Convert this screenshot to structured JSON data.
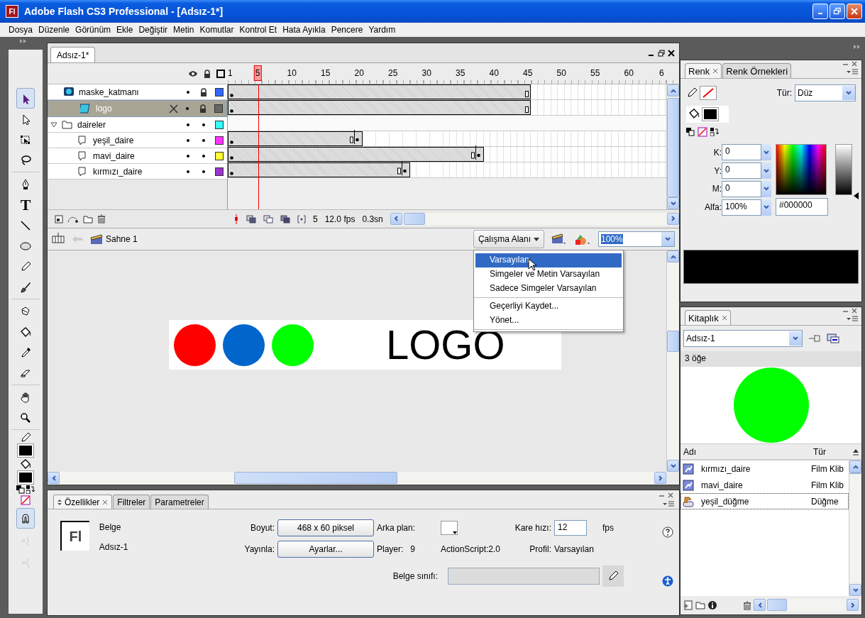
{
  "window": {
    "icon_text": "Fl",
    "title": "Adobe Flash CS3 Professional - [Adsız-1*]"
  },
  "menu": [
    "Dosya",
    "Düzenle",
    "Görünüm",
    "Ekle",
    "Değiştir",
    "Metin",
    "Komutlar",
    "Kontrol Et",
    "Hata Ayıkla",
    "Pencere",
    "Yardım"
  ],
  "toolbox": {
    "groups": [
      [
        {
          "kind": "selection",
          "selected": true
        },
        {
          "kind": "subselection",
          "selected": false
        },
        {
          "kind": "free-transform",
          "selected": false
        },
        {
          "kind": "lasso",
          "selected": false
        }
      ],
      [
        {
          "kind": "pen",
          "selected": false
        },
        {
          "kind": "text",
          "glyph": "T",
          "selected": false
        },
        {
          "kind": "line",
          "selected": false
        },
        {
          "kind": "oval",
          "selected": false
        },
        {
          "kind": "pencil",
          "selected": false
        },
        {
          "kind": "brush",
          "selected": false
        }
      ],
      [
        {
          "kind": "ink-bottle",
          "selected": false
        },
        {
          "kind": "paint-bucket",
          "selected": false
        },
        {
          "kind": "eyedropper",
          "selected": false
        },
        {
          "kind": "eraser",
          "selected": false
        }
      ],
      [
        {
          "kind": "hand",
          "selected": false
        },
        {
          "kind": "zoom",
          "selected": false
        }
      ]
    ],
    "options": [
      {
        "kind": "snap",
        "selected": true,
        "disabled": false
      },
      {
        "kind": "smooth",
        "selected": false,
        "disabled": true
      },
      {
        "kind": "straighten",
        "selected": false,
        "disabled": true
      }
    ]
  },
  "document_tabs": [
    {
      "label": "Adsız-1*",
      "selected": true
    }
  ],
  "timeline": {
    "ruler": [
      {
        "label": "1",
        "current": false
      },
      {
        "label": "5",
        "current": true
      },
      {
        "label": "10",
        "current": false
      },
      {
        "label": "15",
        "current": false
      },
      {
        "label": "20",
        "current": false
      },
      {
        "label": "25",
        "current": false
      },
      {
        "label": "30",
        "current": false
      },
      {
        "label": "35",
        "current": false
      },
      {
        "label": "40",
        "current": false
      },
      {
        "label": "45",
        "current": false
      },
      {
        "label": "50",
        "current": false
      },
      {
        "label": "55",
        "current": false
      },
      {
        "label": "60",
        "current": false
      },
      {
        "label": "6",
        "current": false
      }
    ],
    "layers": [
      {
        "name": "maske_katmanı",
        "kind": "mask",
        "selected": false,
        "locked": true,
        "color": "#3366ff",
        "level": 0.703,
        "end_keyframe": false,
        "children": [
          {
            "name": "logo",
            "kind": "masked",
            "selected": true,
            "locked": true,
            "color": "#666666",
            "level": 0.703,
            "end_keyframe": false
          }
        ]
      },
      {
        "name": "daireler",
        "kind": "folder",
        "expanded": true,
        "selected": false,
        "locked": false,
        "color": "#33ffff",
        "children": [
          {
            "name": "yeşil_daire",
            "kind": "layer",
            "selected": false,
            "locked": false,
            "color": "#ff33ff",
            "level": 0.3125,
            "end_keyframe": true
          },
          {
            "name": "mavi_daire",
            "kind": "layer",
            "selected": false,
            "locked": false,
            "color": "#ffff33",
            "level": 0.594,
            "end_keyframe": true
          },
          {
            "name": "kırmızı_daire",
            "kind": "layer",
            "selected": false,
            "locked": false,
            "color": "#9933cc",
            "level": 0.422,
            "end_keyframe": true
          }
        ]
      }
    ],
    "footer": {
      "current_frame": "5",
      "frame_rate": "12.0 fps",
      "elapsed": "0.3sn"
    }
  },
  "edit_bar": {
    "scene": "Sahne 1",
    "workspace_button": "Çalışma Alanı",
    "zoom": "100%"
  },
  "workspace_menu": {
    "groups": [
      [
        {
          "label": "Varsayılan",
          "selected": true
        },
        {
          "label": "Simgeler ve Metin Varsayılan",
          "selected": false
        },
        {
          "label": "Sadece Simgeler Varsayılan",
          "selected": false
        }
      ],
      [
        {
          "label": "Geçerliyi Kaydet...",
          "selected": false
        },
        {
          "label": "Yönet...",
          "selected": false
        }
      ]
    ]
  },
  "stage": {
    "circles": [
      {
        "color": "#ff0000"
      },
      {
        "color": "#0066cc"
      },
      {
        "color": "#00ff00"
      }
    ],
    "text": "LOGO"
  },
  "properties": {
    "tabs": [
      {
        "label": "Özellikler",
        "selected": true
      },
      {
        "label": "Filtreler",
        "selected": false
      },
      {
        "label": "Parametreler",
        "selected": false
      }
    ],
    "doc_icon": "Fl",
    "doc_type": "Belge",
    "doc_name": "Adsız-1",
    "size_label": "Boyut:",
    "size_button": "468 x 60 piksel",
    "background_label": "Arka plan:",
    "frame_rate_label": "Kare hızı:",
    "frame_rate": "12",
    "fps": "fps",
    "publish_label": "Yayınla:",
    "settings_button": "Ayarlar...",
    "player_label": "Player:",
    "player": "9",
    "actionscript": "ActionScript:2.0",
    "profile_label": "Profil:",
    "profile": "Varsayılan",
    "class_label": "Belge sınıfı:"
  },
  "color_panel": {
    "tabs": [
      {
        "label": "Renk",
        "selected": true
      },
      {
        "label": "Renk Örnekleri",
        "selected": false
      }
    ],
    "type_label": "Tür:",
    "type": "Düz",
    "brightness": {
      "level": 0
    },
    "fields": [
      {
        "label": "K:",
        "value": "0"
      },
      {
        "label": "Y:",
        "value": "0"
      },
      {
        "label": "M:",
        "value": "0"
      },
      {
        "label": "Alfa:",
        "value": "100%"
      }
    ],
    "hex": "#000000"
  },
  "library": {
    "tabs": [
      {
        "label": "Kitaplık",
        "selected": true
      }
    ],
    "document": "Adsız-1",
    "count": "3 öğe",
    "columns": [
      "Adı",
      "Tür"
    ],
    "items": [
      {
        "name": "kırmızı_daire",
        "type": "Film Klib",
        "kind": "movieclip",
        "selected": false
      },
      {
        "name": "mavi_daire",
        "type": "Film Klib",
        "kind": "movieclip",
        "selected": false
      },
      {
        "name": "yeşil_düğme",
        "type": "Düğme",
        "kind": "button",
        "selected": true
      }
    ]
  }
}
